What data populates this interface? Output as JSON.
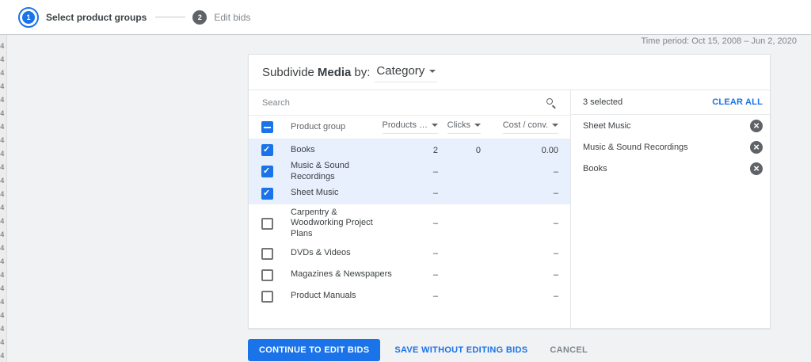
{
  "page": {
    "edge_artifact": "4\n4\n4\n4\n4\n4\n4\n4\n4\n4\n4\n4\n4\n4\n4\n4\n4\n4\n4\n4\n4\n4\n4\n4\n4\n4\n4"
  },
  "stepper": {
    "step1_number": "1",
    "step1_label": "Select product groups",
    "step2_number": "2",
    "step2_label": "Edit bids"
  },
  "header": {
    "time_period": "Time period: Oct 15, 2008 – Jun 2, 2020"
  },
  "dialog": {
    "title": {
      "prefix": "Subdivide",
      "entity": "Media",
      "by": "by:",
      "value": "Category"
    },
    "search": {
      "placeholder": "Search"
    },
    "table": {
      "headers": {
        "product_group": "Product group",
        "products": "Products …",
        "clicks": "Clicks",
        "cost_conv": "Cost / conv."
      },
      "rows": [
        {
          "name": "Books",
          "products": "2",
          "clicks": "0",
          "cost_conv": "0.00",
          "checked": true
        },
        {
          "name": "Music & Sound Recordings",
          "products": "–",
          "clicks": "",
          "cost_conv": "–",
          "checked": true
        },
        {
          "name": "Sheet Music",
          "products": "–",
          "clicks": "",
          "cost_conv": "–",
          "checked": true
        },
        {
          "name": "Carpentry & Woodworking Project Plans",
          "products": "–",
          "clicks": "",
          "cost_conv": "–",
          "checked": false
        },
        {
          "name": "DVDs & Videos",
          "products": "–",
          "clicks": "",
          "cost_conv": "–",
          "checked": false
        },
        {
          "name": "Magazines & Newspapers",
          "products": "–",
          "clicks": "",
          "cost_conv": "–",
          "checked": false
        },
        {
          "name": "Product Manuals",
          "products": "–",
          "clicks": "",
          "cost_conv": "–",
          "checked": false
        }
      ]
    },
    "selected": {
      "count": "3 selected",
      "clear_all": "CLEAR ALL",
      "items": [
        {
          "label": "Sheet Music"
        },
        {
          "label": "Music & Sound Recordings"
        },
        {
          "label": "Books"
        }
      ]
    }
  },
  "actions": {
    "continue": "CONTINUE TO EDIT BIDS",
    "save": "SAVE WITHOUT EDITING BIDS",
    "cancel": "CANCEL"
  },
  "colors": {
    "accent": "#1a73e8",
    "selected_row_bg": "#e8f0fe"
  }
}
